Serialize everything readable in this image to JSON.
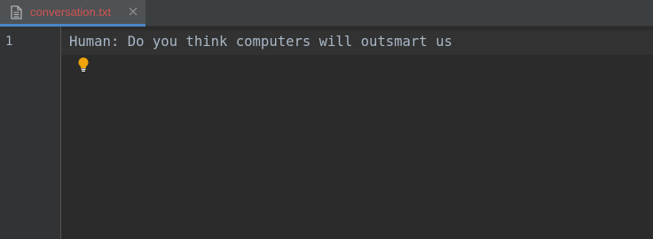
{
  "tab": {
    "file_name": "conversation.txt",
    "file_icon": "file-icon",
    "close_icon": "close-icon"
  },
  "editor": {
    "lines": [
      {
        "number": "1",
        "text": "Human: Do you think computers will outsmart us"
      }
    ],
    "gutter_icon": "lightbulb-icon"
  },
  "colors": {
    "background": "#2b2b2b",
    "tab_label_error": "#d25252",
    "text": "#a9b7c6",
    "bulb": "#f0a30a"
  }
}
